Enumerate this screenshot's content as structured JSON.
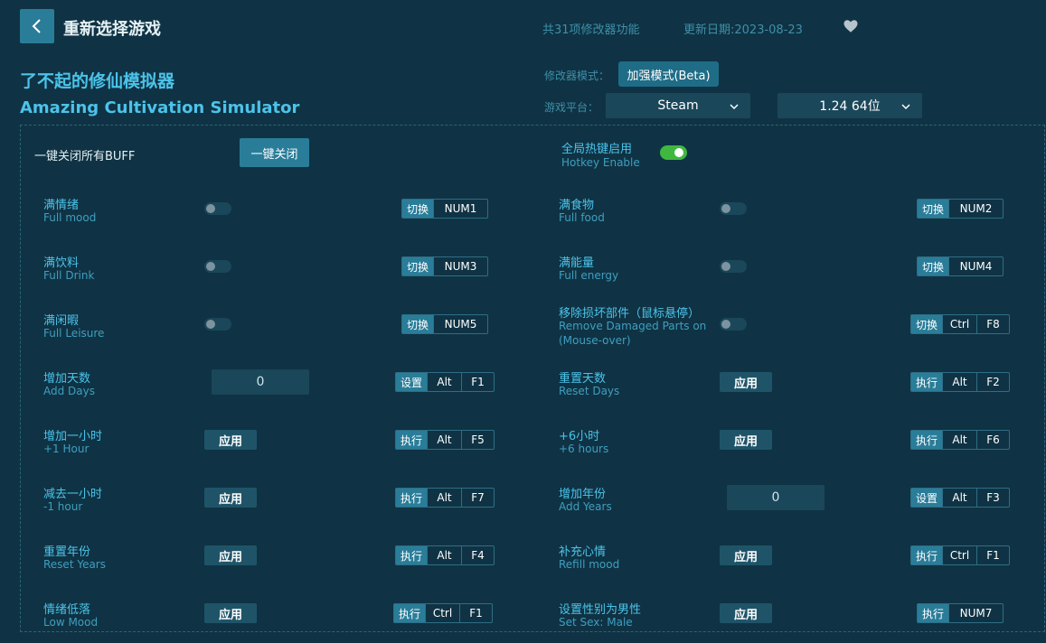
{
  "header": {
    "back_label": "重新选择游戏",
    "feature_count": "共31项修改器功能",
    "update_date": "更新日期:2023-08-23"
  },
  "game": {
    "title_cn": "了不起的修仙模拟器",
    "title_en": "Amazing Cultivation Simulator"
  },
  "settings": {
    "mode_label": "修改器模式：",
    "mode_value": "加强模式(Beta)",
    "platform_label": "游戏平台：",
    "platform_value": "Steam",
    "version_value": "1.24 64位"
  },
  "global": {
    "close_all_label": "一键关闭所有BUFF",
    "close_all_button": "一键关闭",
    "hotkey_cn": "全局热键启用",
    "hotkey_en": "Hotkey Enable",
    "hotkey_enabled": true
  },
  "left_rows": [
    {
      "cn": "满情绪",
      "en": "Full mood",
      "control": "toggle",
      "keys": [
        "切换",
        "NUM1"
      ]
    },
    {
      "cn": "满饮料",
      "en": "Full Drink",
      "control": "toggle",
      "keys": [
        "切换",
        "NUM3"
      ]
    },
    {
      "cn": "满闲暇",
      "en": "Full Leisure",
      "control": "toggle",
      "keys": [
        "切换",
        "NUM5"
      ]
    },
    {
      "cn": "增加天数",
      "en": "Add Days",
      "control": "input",
      "value": "0",
      "keys": [
        "设置",
        "Alt",
        "F1"
      ]
    },
    {
      "cn": "增加一小时",
      "en": "+1 Hour",
      "control": "apply",
      "button": "应用",
      "keys": [
        "执行",
        "Alt",
        "F5"
      ]
    },
    {
      "cn": "减去一小时",
      "en": "-1 hour",
      "control": "apply",
      "button": "应用",
      "keys": [
        "执行",
        "Alt",
        "F7"
      ]
    },
    {
      "cn": "重置年份",
      "en": "Reset Years",
      "control": "apply",
      "button": "应用",
      "keys": [
        "执行",
        "Alt",
        "F4"
      ]
    },
    {
      "cn": "情绪低落",
      "en": "Low Mood",
      "control": "apply",
      "button": "应用",
      "keys": [
        "执行",
        "Ctrl",
        "F1"
      ]
    }
  ],
  "right_rows": [
    {
      "cn": "满食物",
      "en": "Full food",
      "control": "toggle",
      "keys": [
        "切换",
        "NUM2"
      ]
    },
    {
      "cn": "满能量",
      "en": "Full energy",
      "control": "toggle",
      "keys": [
        "切换",
        "NUM4"
      ]
    },
    {
      "cn": "移除损坏部件（鼠标悬停）",
      "en": "Remove Damaged Parts on",
      "en2": "(Mouse-over)",
      "control": "toggle",
      "keys": [
        "切换",
        "Ctrl",
        "F8"
      ]
    },
    {
      "cn": "重置天数",
      "en": "Reset Days",
      "control": "apply",
      "button": "应用",
      "keys": [
        "执行",
        "Alt",
        "F2"
      ]
    },
    {
      "cn": "+6小时",
      "en": "+6 hours",
      "control": "apply",
      "button": "应用",
      "keys": [
        "执行",
        "Alt",
        "F6"
      ]
    },
    {
      "cn": "增加年份",
      "en": "Add Years",
      "control": "input",
      "value": "0",
      "keys": [
        "设置",
        "Alt",
        "F3"
      ]
    },
    {
      "cn": "补充心情",
      "en": "Refill mood",
      "control": "apply",
      "button": "应用",
      "keys": [
        "执行",
        "Ctrl",
        "F1"
      ]
    },
    {
      "cn": "设置性别为男性",
      "en": "Set Sex: Male",
      "control": "apply",
      "button": "应用",
      "keys": [
        "执行",
        "NUM7"
      ]
    }
  ],
  "icons": {
    "back": "chevron-left-icon",
    "favorite": "heart-icon",
    "dropdown": "chevron-down-icon"
  },
  "colors": {
    "background": "#0f3344",
    "accent": "#2a7d99",
    "title": "#4cc3ea",
    "toggle_on": "#3fb83f"
  }
}
